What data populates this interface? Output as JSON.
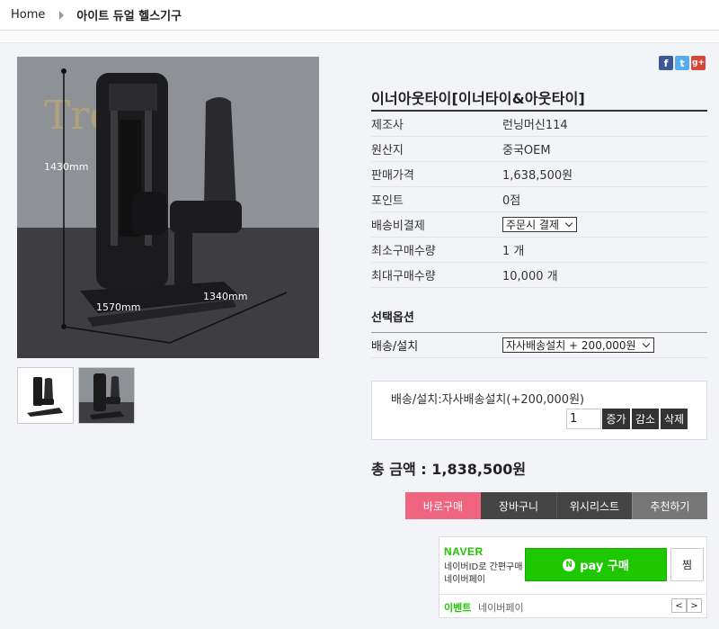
{
  "breadcrumb": {
    "home": "Home",
    "current": "아이트 듀얼 헬스기구"
  },
  "share": {
    "facebook": "f",
    "twitter": "t",
    "googleplus": "g+"
  },
  "image": {
    "label_height": "1430mm",
    "label_length": "1570mm",
    "label_width": "1340mm",
    "wall_text": "Tre"
  },
  "product": {
    "title": "이너아웃타이[이너타이&아웃타이]",
    "rows": [
      {
        "label": "제조사",
        "value": "런닝머신114"
      },
      {
        "label": "원산지",
        "value": "중국OEM"
      },
      {
        "label": "판매가격",
        "value": "1,638,500원"
      },
      {
        "label": "포인트",
        "value": "0점"
      },
      {
        "label": "배송비결제",
        "value": "주문시 결제"
      },
      {
        "label": "최소구매수량",
        "value": "1 개"
      },
      {
        "label": "최대구매수량",
        "value": "10,000 개"
      }
    ]
  },
  "options": {
    "heading": "선택옵션",
    "label": "배송/설치",
    "selected": "자사배송설치  + 200,000원"
  },
  "selection": {
    "name": "배송/설치:자사배송설치(+200,000원)",
    "qty": "1",
    "increase": "증가",
    "decrease": "감소",
    "delete": "삭제"
  },
  "total": "총 금액 : 1,838,500원",
  "actions": {
    "buy": "바로구매",
    "cart": "장바구니",
    "wish": "위시리스트",
    "recommend": "추천하기"
  },
  "naver": {
    "logo": "NAVER",
    "desc1": "네이버ID로 간편구매",
    "desc2": "네이버페이",
    "pay_n": "N",
    "pay_label": "pay 구매",
    "jjim": "찜",
    "event": "이벤트",
    "event_text": "네이버페이",
    "prev": "<",
    "next": ">"
  },
  "colors": {
    "buy": "#ef6580",
    "naver_green": "#1ec800",
    "dark_btn": "#333333"
  }
}
